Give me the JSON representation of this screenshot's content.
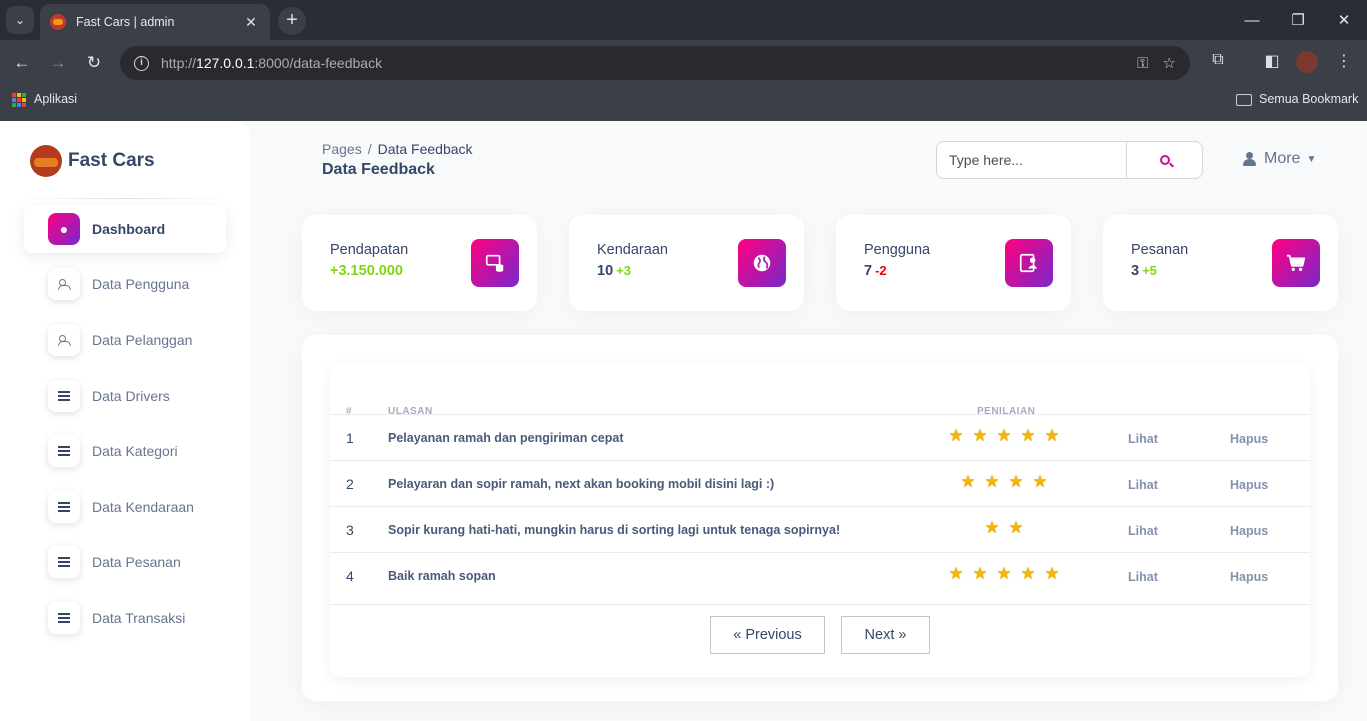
{
  "browser": {
    "tab_title": "Fast Cars | admin",
    "url_host": "127.0.0.1",
    "url_prefix": "http://",
    "url_rest": ":8000/data-feedback",
    "bookmark_apps": "Aplikasi",
    "bookmark_all": "Semua Bookmark"
  },
  "sidebar": {
    "brand": "Fast Cars",
    "items": [
      {
        "label": "Dashboard",
        "icon": "bell-icon"
      },
      {
        "label": "Data Pengguna",
        "icon": "users-icon"
      },
      {
        "label": "Data Pelanggan",
        "icon": "users-icon"
      },
      {
        "label": "Data Drivers",
        "icon": "list-icon"
      },
      {
        "label": "Data Kategori",
        "icon": "list-icon"
      },
      {
        "label": "Data Kendaraan",
        "icon": "list-icon"
      },
      {
        "label": "Data Pesanan",
        "icon": "list-icon"
      },
      {
        "label": "Data Transaksi",
        "icon": "list-icon"
      }
    ]
  },
  "header": {
    "breadcrumb_root": "Pages",
    "breadcrumb_separator": "/",
    "breadcrumb_current": "Data Feedback",
    "title": "Data Feedback",
    "search_placeholder": "Type here...",
    "more_label": "More"
  },
  "stats": [
    {
      "label": "Pendapatan",
      "value": "+3.150.000",
      "delta": "",
      "icon": "money-icon"
    },
    {
      "label": "Kendaraan",
      "value": "10",
      "delta": "+3",
      "icon": "globe-icon"
    },
    {
      "label": "Pengguna",
      "value": "7",
      "delta": "-2",
      "icon": "user-card-icon"
    },
    {
      "label": "Pesanan",
      "value": "3",
      "delta": "+5",
      "icon": "cart-icon"
    }
  ],
  "table": {
    "headers": {
      "num": "#",
      "review": "ULASAN",
      "rating": "PENILAIAN"
    },
    "rows": [
      {
        "num": "1",
        "review": "Pelayanan ramah dan pengiriman cepat",
        "stars": 5,
        "view": "Lihat",
        "delete": "Hapus"
      },
      {
        "num": "2",
        "review": "Pelayaran dan sopir ramah, next akan booking mobil disini lagi :)",
        "stars": 4,
        "view": "Lihat",
        "delete": "Hapus"
      },
      {
        "num": "3",
        "review": "Sopir kurang hati-hati, mungkin harus di sorting lagi untuk tenaga sopirnya!",
        "stars": 2,
        "view": "Lihat",
        "delete": "Hapus"
      },
      {
        "num": "4",
        "review": "Baik ramah sopan",
        "stars": 5,
        "view": "Lihat",
        "delete": "Hapus"
      }
    ],
    "prev_label": "« Previous",
    "next_label": "Next »"
  },
  "colors": {
    "accent_gradient_start": "#7928ca",
    "accent_gradient_end": "#ff0080",
    "positive": "#82d616",
    "negative": "#ea0606",
    "star": "#f5b400"
  }
}
